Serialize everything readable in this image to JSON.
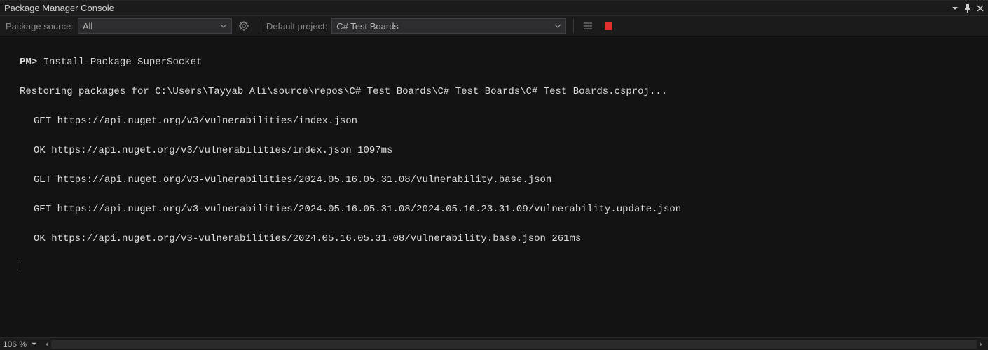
{
  "titlebar": {
    "title": "Package Manager Console"
  },
  "toolbar": {
    "package_source_label": "Package source:",
    "package_source_value": "All",
    "default_project_label": "Default project:",
    "default_project_value": "C# Test Boards"
  },
  "console": {
    "prompt": "PM>",
    "command": "Install-Package SuperSocket",
    "lines": {
      "l0": "Restoring packages for C:\\Users\\Tayyab Ali\\source\\repos\\C# Test Boards\\C# Test Boards\\C# Test Boards.csproj...",
      "l1": "GET https://api.nuget.org/v3/vulnerabilities/index.json",
      "l2": "OK https://api.nuget.org/v3/vulnerabilities/index.json 1097ms",
      "l3": "GET https://api.nuget.org/v3-vulnerabilities/2024.05.16.05.31.08/vulnerability.base.json",
      "l4": "GET https://api.nuget.org/v3-vulnerabilities/2024.05.16.05.31.08/2024.05.16.23.31.09/vulnerability.update.json",
      "l5": "OK https://api.nuget.org/v3-vulnerabilities/2024.05.16.05.31.08/vulnerability.base.json 261ms"
    }
  },
  "statusbar": {
    "zoom": "106 %"
  }
}
